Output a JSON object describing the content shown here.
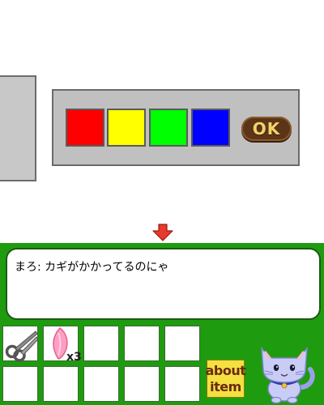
{
  "lock_panel": {
    "colors": [
      {
        "name": "red",
        "hex": "#ff0000"
      },
      {
        "name": "yellow",
        "hex": "#ffff00"
      },
      {
        "name": "green",
        "hex": "#00ff00"
      },
      {
        "name": "blue",
        "hex": "#0000ff"
      }
    ],
    "ok_label": "OK"
  },
  "dialog": {
    "message": "まろ: カギがかかってるのにゃ"
  },
  "inventory": {
    "items": [
      {
        "icon": "scissors-icon",
        "count": ""
      },
      {
        "icon": "petal-icon",
        "count": "x3"
      }
    ]
  },
  "about_button": {
    "line1": "about",
    "line2": "item"
  },
  "colors": {
    "background_green": "#1f9b0f",
    "arrow_red": "#e53a2c"
  }
}
